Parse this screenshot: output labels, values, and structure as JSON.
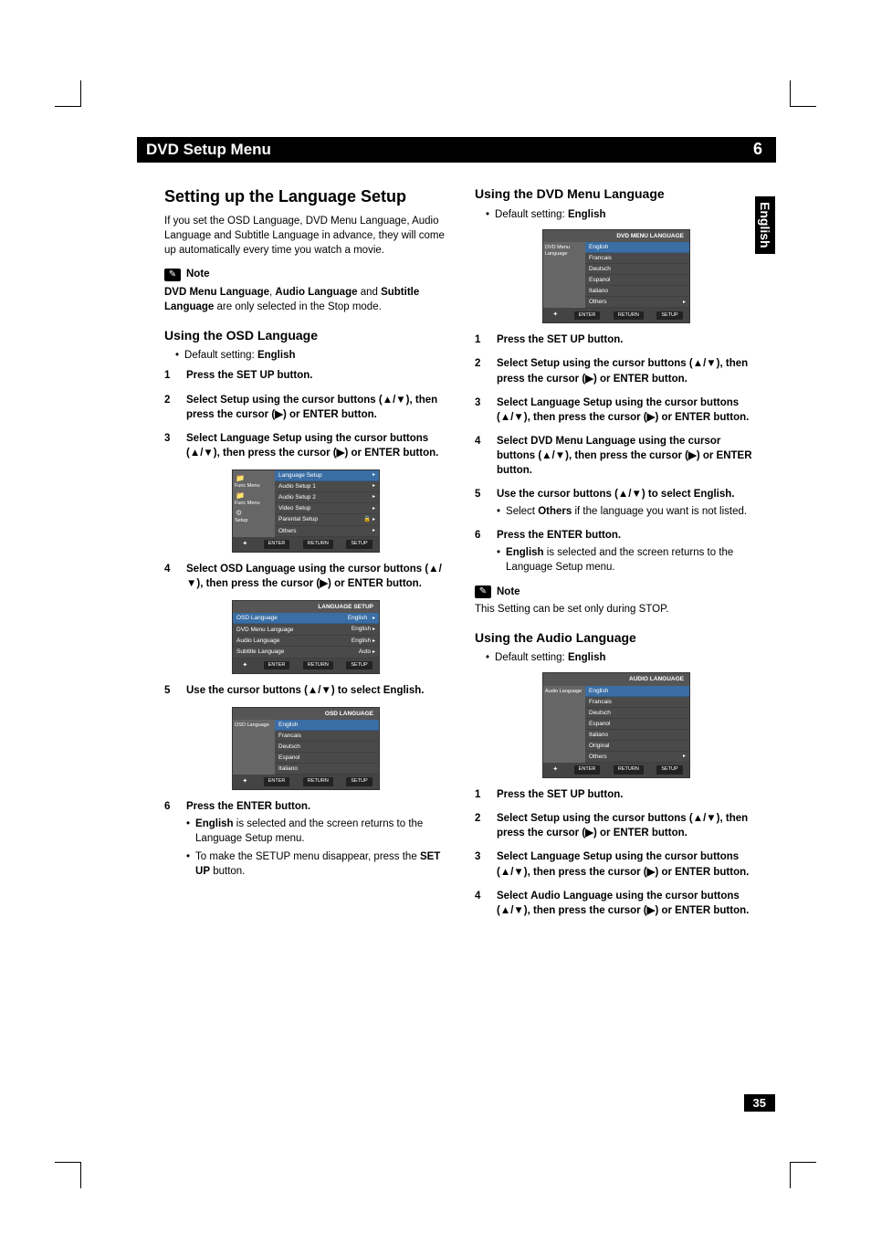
{
  "header": {
    "title": "DVD Setup Menu",
    "chapter": "6"
  },
  "side_tab": "English",
  "page_number": "35",
  "left": {
    "main_heading": "Setting up the Language Setup",
    "intro": "If you set the OSD Language, DVD Menu Language, Audio Language and Subtitle Language in advance, they will come up automatically every time you watch a movie.",
    "note_label": "Note",
    "note_body_parts": [
      "DVD Menu Language",
      ", ",
      "Audio Language",
      " and ",
      "Subtitle Language",
      " are only selected in the Stop mode."
    ],
    "h_osd": "Using the OSD Language",
    "default_label": "Default setting:",
    "default_value": "English",
    "steps": [
      {
        "n": "1",
        "body": "Press the SET UP button."
      },
      {
        "n": "2",
        "body_pre": "Select ",
        "body_heavy": "Setup",
        "body_post": " using the cursor buttons (▲/▼), then press the cursor (▶) or ENTER button."
      },
      {
        "n": "3",
        "body_pre": "Select ",
        "body_heavy": "Language Setup",
        "body_post": " using the cursor buttons (▲/▼), then press the cursor (▶) or ENTER button."
      },
      {
        "n": "4",
        "body_pre": "Select ",
        "body_heavy": "OSD Language",
        "body_post": " using the cursor buttons (▲/▼), then press the cursor (▶) or ENTER button."
      },
      {
        "n": "5",
        "body_pre": "Use the cursor buttons (▲/▼) to select ",
        "body_heavy": "English",
        "body_post": "."
      },
      {
        "n": "6",
        "body": "Press the ENTER button.",
        "subs": [
          {
            "strong": "English",
            "rest": " is selected and the screen returns to the Language Setup menu."
          },
          {
            "rest_pre": "To make the SETUP menu disappear, press the ",
            "strong": "SET UP",
            "rest": " button."
          }
        ]
      }
    ],
    "osd1": {
      "side_items": [
        "Func Menu",
        "",
        "Func Menu",
        "",
        "",
        "Setup"
      ],
      "rows": [
        {
          "label": "Language Setup",
          "hl": true
        },
        {
          "label": "Audio Setup 1"
        },
        {
          "label": "Audio Setup 2"
        },
        {
          "label": "Video Setup"
        },
        {
          "label": "Parental Setup",
          "lock": true
        },
        {
          "label": "Others"
        }
      ],
      "foot": [
        "ENTER",
        "RETURN",
        "SETUP"
      ]
    },
    "osd2": {
      "title": "LANGUAGE SETUP",
      "rows": [
        {
          "label": "OSD Language",
          "val": "English",
          "hl": true
        },
        {
          "label": "DVD Menu Language",
          "val": "English"
        },
        {
          "label": "Audio  Language",
          "val": "English"
        },
        {
          "label": "Subtitle  Language",
          "val": "Auto"
        }
      ],
      "foot": [
        "ENTER",
        "RETURN",
        "SETUP"
      ]
    },
    "osd3": {
      "title": "OSD LANGUAGE",
      "side_label": "OSD Language",
      "rows": [
        {
          "label": "English",
          "hl": true
        },
        {
          "label": "Francais"
        },
        {
          "label": "Deutsch"
        },
        {
          "label": "Espanol"
        },
        {
          "label": "Italiano"
        }
      ],
      "foot": [
        "ENTER",
        "RETURN",
        "SETUP"
      ]
    }
  },
  "right": {
    "h_dvd": "Using the DVD Menu Language",
    "default_label": "Default setting:",
    "default_value": "English",
    "osd1": {
      "title": "DVD MENU LANGUAGE",
      "side_label": "DVD Menu Language",
      "rows": [
        {
          "label": "English",
          "hl": true
        },
        {
          "label": "Francais"
        },
        {
          "label": "Deutsch"
        },
        {
          "label": "Espanol"
        },
        {
          "label": "Italiano"
        },
        {
          "label": "Others"
        }
      ],
      "foot": [
        "ENTER",
        "RETURN",
        "SETUP"
      ]
    },
    "steps_dvd": [
      {
        "n": "1",
        "body": "Press the SET UP button."
      },
      {
        "n": "2",
        "body_pre": "Select ",
        "body_heavy": "Setup",
        "body_post": " using the cursor buttons (▲/▼), then press the cursor (▶) or ENTER button."
      },
      {
        "n": "3",
        "body_pre": "Select ",
        "body_heavy": "Language Setup",
        "body_post": " using the cursor buttons (▲/▼), then press the cursor (▶) or ENTER button."
      },
      {
        "n": "4",
        "body_pre": "Select ",
        "body_heavy": "DVD Menu Language",
        "body_post": " using the cursor buttons (▲/▼), then press the cursor (▶) or ENTER button."
      },
      {
        "n": "5",
        "body_pre": "Use the cursor buttons (▲/▼) to select ",
        "body_heavy": "English",
        "body_post": ".",
        "subs": [
          {
            "rest_pre": "Select ",
            "strong": "Others",
            "rest": " if the language you want is not listed."
          }
        ]
      },
      {
        "n": "6",
        "body": "Press the ENTER button.",
        "subs": [
          {
            "strong": "English",
            "rest": " is selected and the screen returns to the Language Setup menu."
          }
        ]
      }
    ],
    "note_label": "Note",
    "note_body": "This Setting can be set only during STOP.",
    "h_audio": "Using the Audio Language",
    "osd2": {
      "title": "AUDIO LANGUAGE",
      "side_label": "Audio Language",
      "rows": [
        {
          "label": "English",
          "hl": true
        },
        {
          "label": "Francais"
        },
        {
          "label": "Deutsch"
        },
        {
          "label": "Espanol"
        },
        {
          "label": "Italiano"
        },
        {
          "label": "Original"
        },
        {
          "label": "Others"
        }
      ],
      "foot": [
        "ENTER",
        "RETURN",
        "SETUP"
      ]
    },
    "steps_audio": [
      {
        "n": "1",
        "body": "Press the SET UP button."
      },
      {
        "n": "2",
        "body_pre": "Select ",
        "body_heavy": "Setup",
        "body_post": " using the cursor buttons (▲/▼), then press the cursor (▶) or ENTER button."
      },
      {
        "n": "3",
        "body_pre": "Select ",
        "body_heavy": "Language Setup",
        "body_post": " using the cursor buttons (▲/▼), then press the cursor (▶) or ENTER button."
      },
      {
        "n": "4",
        "body_pre": "Select ",
        "body_heavy": "Audio Language",
        "body_post": " using the cursor buttons (▲/▼), then press the cursor (▶) or ENTER button."
      }
    ]
  }
}
